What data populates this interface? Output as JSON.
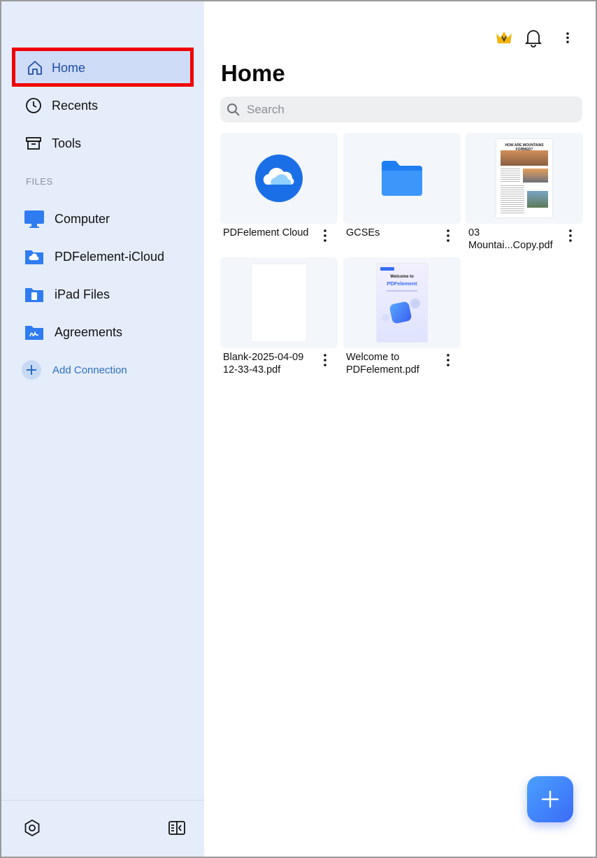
{
  "sidebar": {
    "home_label": "Home",
    "recents_label": "Recents",
    "tools_label": "Tools",
    "files_section": "FILES",
    "files": [
      {
        "label": "Computer",
        "icon": "computer-icon"
      },
      {
        "label": "PDFelement-iCloud",
        "icon": "cloud-folder-icon"
      },
      {
        "label": "iPad Files",
        "icon": "ipad-folder-icon"
      },
      {
        "label": "Agreements",
        "icon": "signature-folder-icon"
      }
    ],
    "add_connection": "Add Connection"
  },
  "main": {
    "title": "Home",
    "search_placeholder": "Search",
    "items": [
      {
        "label": "PDFelement Cloud",
        "kind": "cloud"
      },
      {
        "label": "GCSEs",
        "kind": "folder"
      },
      {
        "label": "03 Mountai...Copy.pdf",
        "kind": "pdf",
        "thumb_heading": "HOW ARE MOUNTAINS FORMED?"
      },
      {
        "label": "Blank-2025-04-09 12-33-43.pdf",
        "kind": "blank-pdf"
      },
      {
        "label": "Welcome to PDFelement.pdf",
        "kind": "pdf",
        "thumb_heading": "Welcome to",
        "thumb_brand": "PDFelement"
      }
    ]
  },
  "colors": {
    "sidebar_bg": "#e5edfb",
    "accent": "#2b6ec3",
    "highlight_border": "#f00000",
    "fab": "#3b6cf7"
  }
}
